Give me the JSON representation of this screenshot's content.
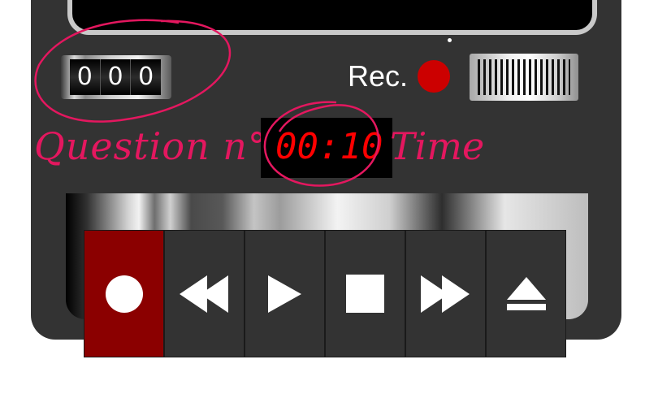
{
  "counter": {
    "digits": [
      "0",
      "0",
      "0"
    ]
  },
  "recorder": {
    "rec_label": "Rec."
  },
  "annotations": {
    "question_label": "Question n°",
    "time_label": "Time"
  },
  "timer": {
    "display": "00:10"
  },
  "controls": [
    {
      "name": "record",
      "icon": "record-circle-icon"
    },
    {
      "name": "rewind",
      "icon": "rewind-icon"
    },
    {
      "name": "play",
      "icon": "play-icon"
    },
    {
      "name": "stop",
      "icon": "stop-icon"
    },
    {
      "name": "fast-forward",
      "icon": "fast-forward-icon"
    },
    {
      "name": "eject",
      "icon": "eject-icon"
    }
  ],
  "colors": {
    "body": "#333333",
    "record_button": "#8b0000",
    "rec_light": "#cc0000",
    "timer_text": "#ff0000",
    "annotation": "#e4175f"
  }
}
